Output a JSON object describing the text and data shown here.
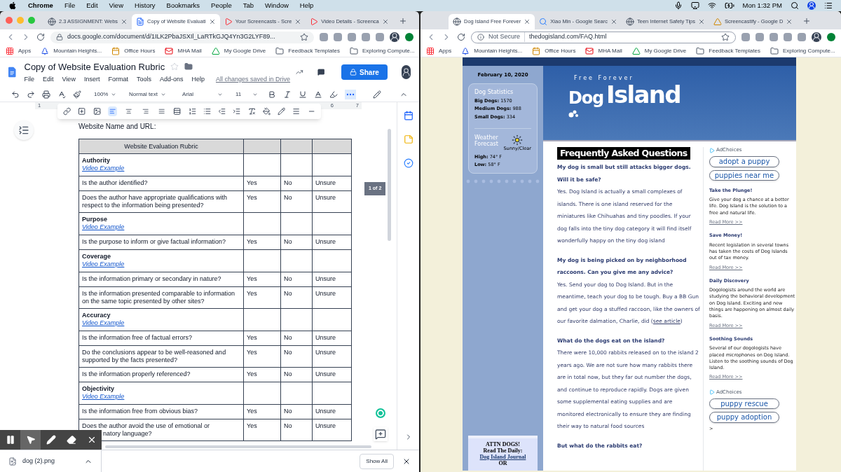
{
  "menubar": {
    "app": "Chrome",
    "items": [
      "File",
      "Edit",
      "View",
      "History",
      "Bookmarks",
      "People",
      "Tab",
      "Window",
      "Help"
    ],
    "clock": "Mon 1:32 PM"
  },
  "left_window": {
    "tabs": [
      {
        "title": "2.3 ASSIGNMENT: Webs",
        "kind": "site",
        "selected": false
      },
      {
        "title": "Copy of Website Evaluati",
        "kind": "docs",
        "selected": true
      },
      {
        "title": "Your Screencasts - Scre",
        "kind": "screencast",
        "selected": false
      },
      {
        "title": "Video Details - Screenca",
        "kind": "screencast",
        "selected": false
      }
    ],
    "url": "docs.google.com/document/d/1ILK2PbaJSXIl_LaRTkGJQ4Yn3G2LYF89...",
    "bookmarks": [
      {
        "label": "Apps",
        "kind": "apps"
      },
      {
        "label": "Mountain Heights...",
        "kind": "site"
      },
      {
        "label": "Office Hours",
        "kind": "calendar"
      },
      {
        "label": "MHA Mail",
        "kind": "mail"
      },
      {
        "label": "My Google Drive",
        "kind": "drive"
      },
      {
        "label": "Feedback Templates",
        "kind": "folder"
      },
      {
        "label": "Exploring Compute...",
        "kind": "folder"
      }
    ],
    "doc_title": "Copy of Website Evaluation Rubric",
    "doc_menu": [
      "File",
      "Edit",
      "View",
      "Insert",
      "Format",
      "Tools",
      "Add-ons",
      "Help"
    ],
    "save_status": "All changes saved in Drive",
    "share": "Share",
    "toolbar": {
      "zoom": "100%",
      "style": "Normal text",
      "font": "Arial",
      "size": "11"
    },
    "align_buttons": [
      {
        "kind": "left",
        "selected": true
      },
      {
        "kind": "center",
        "selected": false
      },
      {
        "kind": "right",
        "selected": false
      },
      {
        "kind": "justify",
        "selected": false
      }
    ],
    "ruler": [
      "1",
      "6",
      "7"
    ],
    "doc_heading": "Website Name and URL:",
    "page_indicator": "1 of 2",
    "table": {
      "columns": [
        "Website Evaluation Rubric"
      ],
      "rows": [
        {
          "kind": "section",
          "title": "Authority",
          "link": "Video Example"
        },
        {
          "kind": "question",
          "text": "Is the author identified?",
          "options": [
            "Yes",
            "No",
            "Unsure"
          ]
        },
        {
          "kind": "question",
          "text": "Does the author have appropriate qualifications with respect to the information being presented?",
          "options": [
            "Yes",
            "No",
            "Unsure"
          ]
        },
        {
          "kind": "section",
          "title": "Purpose",
          "link": "Video Example"
        },
        {
          "kind": "question",
          "text": "Is the purpose to inform or give factual information?",
          "options": [
            "Yes",
            "No",
            "Unsure"
          ]
        },
        {
          "kind": "section",
          "title": "Coverage",
          "link": "Video Example"
        },
        {
          "kind": "question",
          "text": "Is the information primary or secondary in nature?",
          "options": [
            "Yes",
            "No",
            "Unsure"
          ]
        },
        {
          "kind": "question",
          "text": "Is the information presented comparable to information on the same topic presented by other sites?",
          "options": [
            "Yes",
            "No",
            "Unsure"
          ]
        },
        {
          "kind": "section",
          "title": "Accuracy",
          "link": "Video Example"
        },
        {
          "kind": "question",
          "text": "Is the information free of factual errors?",
          "options": [
            "Yes",
            "No",
            "Unsure"
          ]
        },
        {
          "kind": "question",
          "text": "Do the conclusions appear to be well-reasoned and supported by the facts presented?",
          "options": [
            "Yes",
            "No",
            "Unsure"
          ]
        },
        {
          "kind": "question",
          "text": "Is the information properly referenced?",
          "options": [
            "Yes",
            "No",
            "Unsure"
          ]
        },
        {
          "kind": "section",
          "title": "Objectivity",
          "link": "Video Example"
        },
        {
          "kind": "question",
          "text": "Is the information free from obvious bias?",
          "options": [
            "Yes",
            "No",
            "Unsure"
          ]
        },
        {
          "kind": "partial",
          "text": "Does the author avoid the use of emotional or",
          "text_end": "natory language?",
          "options": [
            "Yes",
            "No",
            "Unsure"
          ]
        }
      ]
    },
    "screencast_tools": [
      {
        "kind": "pause",
        "selected": false
      },
      {
        "kind": "pointer",
        "selected": true
      },
      {
        "kind": "pen",
        "selected": false
      },
      {
        "kind": "eraser",
        "selected": false
      },
      {
        "kind": "close",
        "selected": false
      }
    ],
    "downloads": {
      "file": "dog (2).png",
      "show_all": "Show All"
    }
  },
  "right_window": {
    "tabs": [
      {
        "title": "Dog Island Free Forever",
        "kind": "site",
        "selected": true
      },
      {
        "title": "Xiao Min - Google Searc",
        "kind": "google",
        "selected": false
      },
      {
        "title": "Teen Internet Safety Tips",
        "kind": "site",
        "selected": false
      },
      {
        "title": "Screencastify - Google D",
        "kind": "drive",
        "selected": false
      }
    ],
    "security": "Not Secure",
    "url": "thedogisland.com/FAQ.html",
    "bookmarks": [
      {
        "label": "Apps",
        "kind": "apps"
      },
      {
        "label": "Mountain Heights...",
        "kind": "site"
      },
      {
        "label": "Office Hours",
        "kind": "calendar"
      },
      {
        "label": "MHA Mail",
        "kind": "mail"
      },
      {
        "label": "My Google Drive",
        "kind": "drive"
      },
      {
        "label": "Feedback Templates",
        "kind": "folder"
      },
      {
        "label": "Exploring Compute...",
        "kind": "folder"
      }
    ],
    "site": {
      "date": "February 10, 2020",
      "stats_title": "Dog Statistics",
      "stats": [
        {
          "label": "Big Dogs:",
          "value": "1570"
        },
        {
          "label": "Medium Dogs:",
          "value": "988"
        },
        {
          "label": "Small Dogs:",
          "value": "334"
        }
      ],
      "weather_title": "Weather Forecast",
      "condition": "Sunny/Clear",
      "temps": [
        {
          "label": "High:",
          "value": "74° F"
        },
        {
          "label": "Low:",
          "value": "58° F"
        }
      ],
      "tagline": "Free Forever",
      "logo_words": [
        "Dog",
        "Island"
      ],
      "faq_title": "Frequently Asked Questions",
      "faqs": [
        {
          "question": "My dog is small but still attacks bigger dogs. Will it be safe?",
          "answer": "Yes. Dog Island is actually a small complexes of islands. There is one island reserved for the miniatures like Chihuahas and tiny poodles. If your dog falls into the tiny dog category it will find itself wonderfully happy on the tiny dog island"
        },
        {
          "question": "My dog is being picked on by neighborhood raccoons. Can you give me any advice?",
          "answer": "Yes. Send your dog to Dog Island. But in the meantime, teach your dog to be tough. Buy a BB Gun and get your dog a stuffed raccoon, like the owners of our favorite dalmation, Charlie, did (",
          "link": "see article",
          "answer_end": ")"
        },
        {
          "question": "What do the dogs eat on the island?",
          "answer": "There were 10,000 rabbits released on to the island 2 years ago. We are not sure how many rabbits there are in total now, but they far out number the dogs, and continue to reproduce rapidly. Dogs are given some supplemental eating supplies and are monitored electronically to ensure they are finding their way to natural food sources"
        },
        {
          "question": "But what do the rabbits eat?"
        }
      ],
      "adchoices": "AdChoices",
      "ad_buttons": [
        "adopt a puppy",
        "puppies near me"
      ],
      "articles": [
        {
          "title": "Take the Plunge!",
          "body": "Give your dog a chance at a better life. Dog Island is the solution to a free and natural life.",
          "more": "Read More >>"
        },
        {
          "title": "Save Money!",
          "body": "Recent legislation in several towns has taken the costs of Dog Islands out of tax money.",
          "more": "Read More >>"
        },
        {
          "title": "Daily Discovery",
          "body": "Dogologists around the world are studying the behavioral development on Dog Island. Exciting and new things are happening on almost daily basis.",
          "more": "Read More >>"
        },
        {
          "title": "Soothing Sounds",
          "body": "Several of our dogologists have placed microphones on Dog Island. Listen to the soothing sounds of Dog Island.",
          "more": "Read More >>"
        }
      ],
      "adchoices_2": "AdChoices",
      "ad_buttons_2": [
        "puppy rescue",
        "puppy adoption"
      ],
      "ads_more": ">",
      "promo": {
        "lines": [
          "ATTN DOGS!",
          "Read The Daily:"
        ],
        "link": "Dog Island Journal",
        "end": "OR"
      }
    }
  }
}
